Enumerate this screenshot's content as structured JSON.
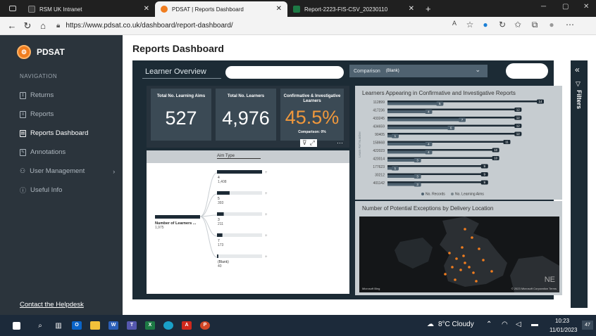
{
  "browser": {
    "tabs": [
      {
        "label": "RSM UK Intranet",
        "active": false
      },
      {
        "label": "PDSAT | Reports Dashboard",
        "active": true
      },
      {
        "label": "Report-2223-FIS-CSV_20230110",
        "active": false
      }
    ],
    "url": "https://www.pdsat.co.uk/dashboard/report-dashboard/"
  },
  "sidebar": {
    "brand": "PDSAT",
    "nav_heading": "NAVIGATION",
    "items": [
      {
        "label": "Returns",
        "icon": "returns-icon"
      },
      {
        "label": "Reports",
        "icon": "reports-icon"
      },
      {
        "label": "Reports Dashboard",
        "icon": "dashboard-icon",
        "active": true
      },
      {
        "label": "Annotations",
        "icon": "annotations-icon"
      },
      {
        "label": "User Management",
        "icon": "user-icon"
      },
      {
        "label": "Useful Info",
        "icon": "info-icon"
      }
    ],
    "helpdesk": "Contact the Helpdesk"
  },
  "main": {
    "title": "Reports Dashboard"
  },
  "report": {
    "title": "Learner Overview",
    "comparison_label": "Comparison",
    "comparison_value": "(Blank)",
    "filters_label": "Filters",
    "kpis": [
      {
        "label": "Total No. Learning Aims",
        "value": "527"
      },
      {
        "label": "Total No. Learners",
        "value": "4,976"
      },
      {
        "label": "Confirmative & Investigative Learners",
        "value": "45.5%",
        "sub": "Comparison: 0%"
      }
    ],
    "aim_type": {
      "header": "Aim Type",
      "root_label": "Number of Learners ...",
      "root_value": "1,975",
      "branches": [
        {
          "label": "4",
          "value": "1,408",
          "fraction": 1.0
        },
        {
          "label": "5",
          "value": "393",
          "fraction": 0.28
        },
        {
          "label": "3",
          "value": "211",
          "fraction": 0.15
        },
        {
          "label": "7",
          "value": "173",
          "fraction": 0.12
        },
        {
          "label": "(Blank)",
          "value": "40",
          "fraction": 0.03
        }
      ]
    },
    "bar_chart_title": "Learners Appearing in Confirmative and Investigative Reports",
    "map_title": "Number of Potential Exceptions by Delivery Location",
    "map_credit": "© 2023 Microsoft Corporation  Terms",
    "map_brand": "Microsoft Bing",
    "map_compass": "NE"
  },
  "chart_data": {
    "type": "bar",
    "orientation": "horizontal",
    "ylabel": "Learn Ref Number",
    "categories": [
      "112899",
      "417236",
      "433245",
      "434659",
      "90405",
      "158668",
      "422023",
      "420014",
      "177623",
      "30212",
      "401142"
    ],
    "series": [
      {
        "name": "No. Records",
        "values": [
          5,
          4,
          7,
          6,
          1,
          4,
          4,
          3,
          1,
          3,
          3
        ],
        "color": "#4f6270"
      },
      {
        "name": "No. Learning Aims",
        "values": [
          14,
          12,
          12,
          12,
          12,
          11,
          10,
          10,
          9,
          9,
          9
        ],
        "color": "#1c2a35"
      }
    ],
    "xlim": [
      0,
      14
    ],
    "legend": "bottom"
  },
  "taskbar": {
    "weather": "8°C  Cloudy",
    "time": "10:23",
    "date": "11/01/2023",
    "notifications": "47"
  }
}
